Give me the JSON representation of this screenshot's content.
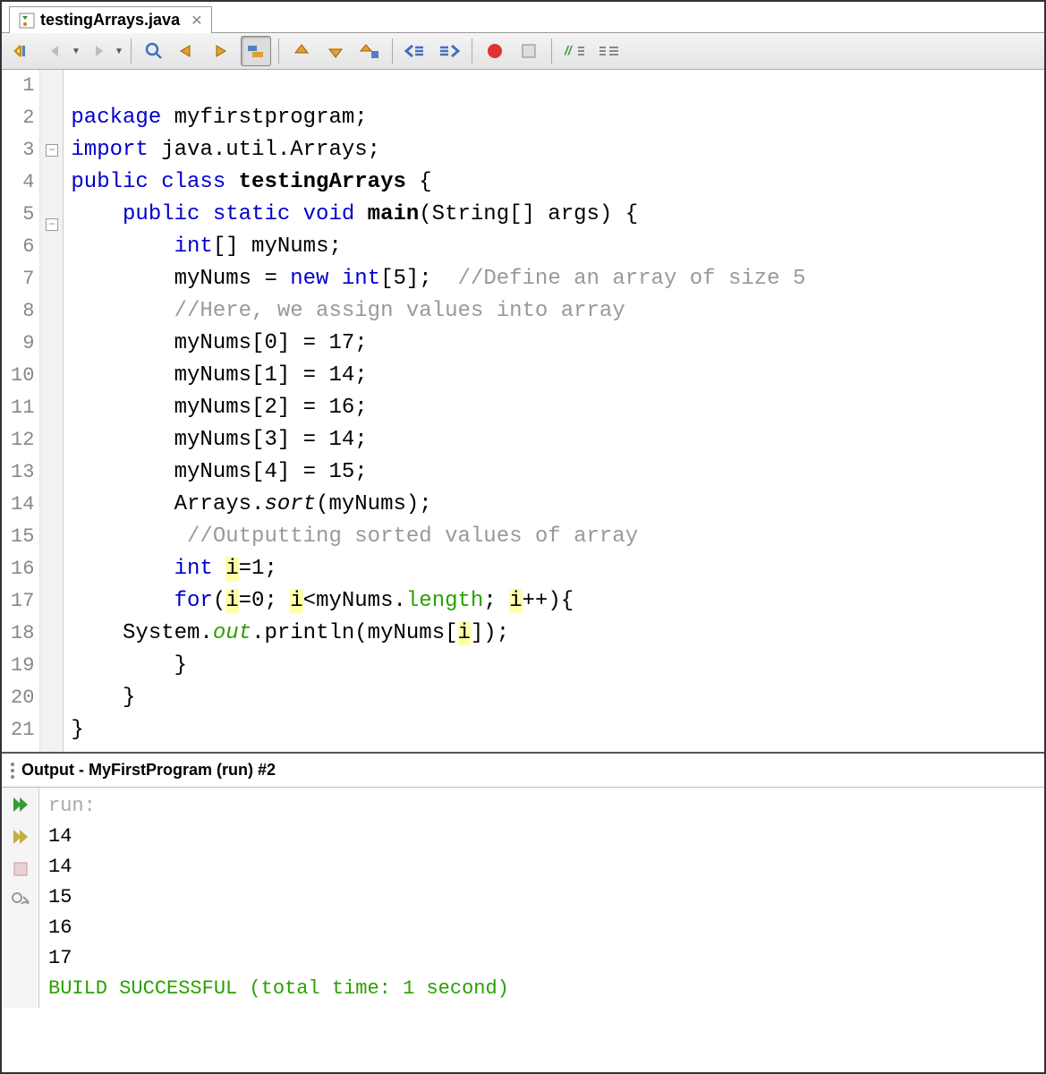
{
  "tab": {
    "filename": "testingArrays.java"
  },
  "code": {
    "lines": [
      {
        "n": 1,
        "html": ""
      },
      {
        "n": 2,
        "html": "<span class='kw'>package</span> myfirstprogram;"
      },
      {
        "n": 3,
        "fold": "minus",
        "html": "<span class='kw'>import</span> java.util.Arrays;"
      },
      {
        "n": 4,
        "html": "<span class='kw'>public class</span> <span class='bold'>testingArrays</span> {"
      },
      {
        "n": 5,
        "fold": "minus",
        "html": "    <span class='kw'>public static</span> <span class='kw'>void</span> <span class='bold'>main</span>(String[] args) {"
      },
      {
        "n": 6,
        "html": "        <span class='kw'>int</span>[] myNums;"
      },
      {
        "n": 7,
        "html": "        myNums = <span class='kw'>new</span> <span class='kw'>int</span>[5];  <span class='cm'>//Define an array of size 5</span>"
      },
      {
        "n": 8,
        "html": "        <span class='cm'>//Here, we assign values into array</span>"
      },
      {
        "n": 9,
        "html": "        myNums[0] = 17;"
      },
      {
        "n": 10,
        "html": "        myNums[1] = 14;"
      },
      {
        "n": 11,
        "html": "        myNums[2] = 16;"
      },
      {
        "n": 12,
        "html": "        myNums[3] = 14;"
      },
      {
        "n": 13,
        "html": "        myNums[4] = 15;"
      },
      {
        "n": 14,
        "html": "        Arrays.<span class='it'>sort</span>(myNums);"
      },
      {
        "n": 15,
        "html": "         <span class='cm'>//Outputting sorted values of array</span>"
      },
      {
        "n": 16,
        "html": "        <span class='kw'>int</span> <span class='hl'>i</span>=1;"
      },
      {
        "n": 17,
        "html": "        <span class='kw'>for</span>(<span class='hl'>i</span>=0; <span class='hl'>i</span>&lt;myNums.<span class='fn'>length</span>; <span class='hl'>i</span>++){"
      },
      {
        "n": 18,
        "html": "    System.<span class='fn it'>out</span>.println(myNums[<span class='hl'>i</span>]);"
      },
      {
        "n": 19,
        "html": "        }"
      },
      {
        "n": 20,
        "html": "    }"
      },
      {
        "n": 21,
        "html": "}"
      }
    ]
  },
  "output": {
    "title": "Output - MyFirstProgram (run) #2",
    "lines": [
      {
        "cls": "run",
        "t": "run:"
      },
      {
        "cls": "",
        "t": "14"
      },
      {
        "cls": "",
        "t": "14"
      },
      {
        "cls": "",
        "t": "15"
      },
      {
        "cls": "",
        "t": "16"
      },
      {
        "cls": "",
        "t": "17"
      },
      {
        "cls": "succ",
        "t": "BUILD SUCCESSFUL (total time: 1 second)"
      }
    ]
  }
}
